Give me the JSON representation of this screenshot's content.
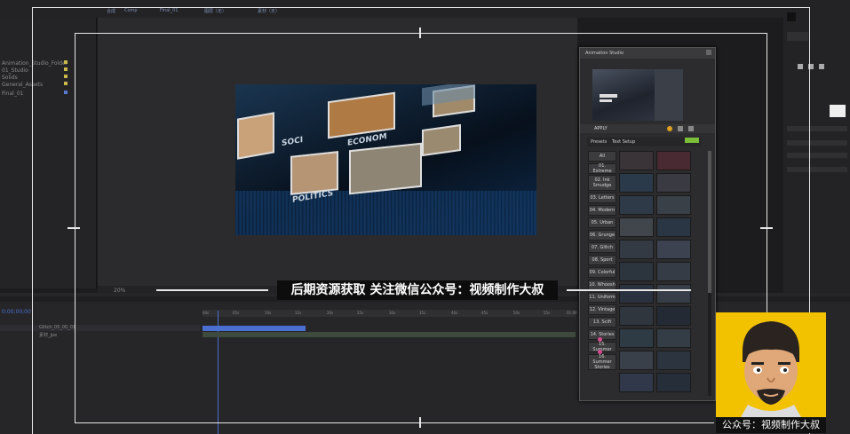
{
  "top": {
    "tabs": [
      "合成",
      "Comp",
      "Final_01",
      "图层（无）",
      "素材（无）"
    ]
  },
  "project": {
    "items": [
      "Animation_Studio_Folder",
      "01_Studio",
      "Solids",
      "General_Assets",
      "Final_01"
    ]
  },
  "composition": {
    "zoom": "20%",
    "video_words": [
      "SOCI",
      "ECONOM",
      "POLITICS"
    ]
  },
  "animation_studio": {
    "title": "Animation Studio",
    "apply_label": "APPLY",
    "tabs": [
      "Presets",
      "Text Setup"
    ],
    "categories": [
      "All",
      "01. Extreme",
      "02. Ink Smudge",
      "03. Letters",
      "04. Modern",
      "05. Urban",
      "06. Grunge",
      "07. Glitch",
      "08. Sport",
      "09. Colorful",
      "10. Whoosh",
      "11. Uniform",
      "12. Vintage",
      "13. Scifi",
      "14. Stories",
      "15. Summer",
      "16. Summer Stories"
    ]
  },
  "timeline": {
    "timecode": "0;00;00;00",
    "layers": [
      "Glitch_05_00_01",
      "素材_Jpe"
    ],
    "ruler": [
      "00s",
      "05s",
      "10s",
      "15s",
      "20s",
      "25s",
      "30s",
      "35s",
      "40s",
      "45s",
      "50s",
      "55s",
      "01:00"
    ]
  },
  "watermark": {
    "text": "后期资源获取 关注微信公众号：视频制作大叔",
    "avatar_caption": "公众号：视频制作大叔"
  },
  "colors": {
    "accent_blue": "#4a6fd0",
    "watermark_yellow": "#f2c200",
    "badge_green": "#7bbf3a",
    "badge_pink": "#d64a8c"
  }
}
